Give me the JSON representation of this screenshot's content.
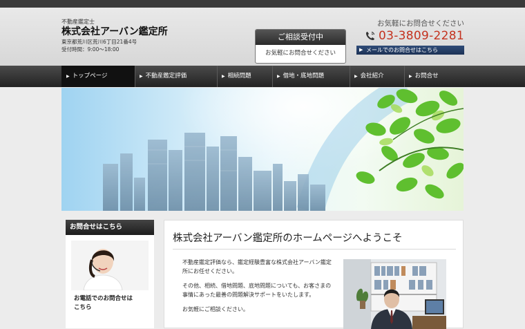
{
  "header": {
    "subtitle": "不動産鑑定士",
    "company": "株式会社アーバン鑑定所",
    "address": "東京都荒川区荒川6丁目21番4号",
    "hours": "受付時間：9:00～18:00"
  },
  "consult": {
    "title": "ご相談受付中",
    "text": "お気軽にお問合せください"
  },
  "contact": {
    "lead": "お気軽にお問合せください",
    "phone": "03-3809-2281",
    "mail_label": "メールでのお問合せはこちら"
  },
  "nav": {
    "items": [
      {
        "label": "トップページ"
      },
      {
        "label": "不動産鑑定評価"
      },
      {
        "label": "相続問題"
      },
      {
        "label": "借地・底地問題"
      },
      {
        "label": "会社紹介"
      },
      {
        "label": "お問合せ"
      }
    ]
  },
  "sidebar": {
    "title": "お問合せはこちら",
    "tel_title": "お電話でのお問合せは\nこちら"
  },
  "main": {
    "heading": "株式会社アーバン鑑定所のホームページへようこそ",
    "paragraphs": [
      "不動産鑑定評価なら、鑑定経験豊富な株式会社アーバン鑑定所にお任せください。",
      "その他、相続、借地問題、底地問題についても、お客さまの事情にあった最善の問題解決サポートをいたします。",
      "お気軽にご相談ください。"
    ]
  },
  "colors": {
    "phone": "#c4321f",
    "mail_button": "#2f4c78",
    "nav_bg": "#2b2b2b"
  },
  "icons": {
    "phone": "phone-icon",
    "mail_arrow": "arrow-icon"
  }
}
